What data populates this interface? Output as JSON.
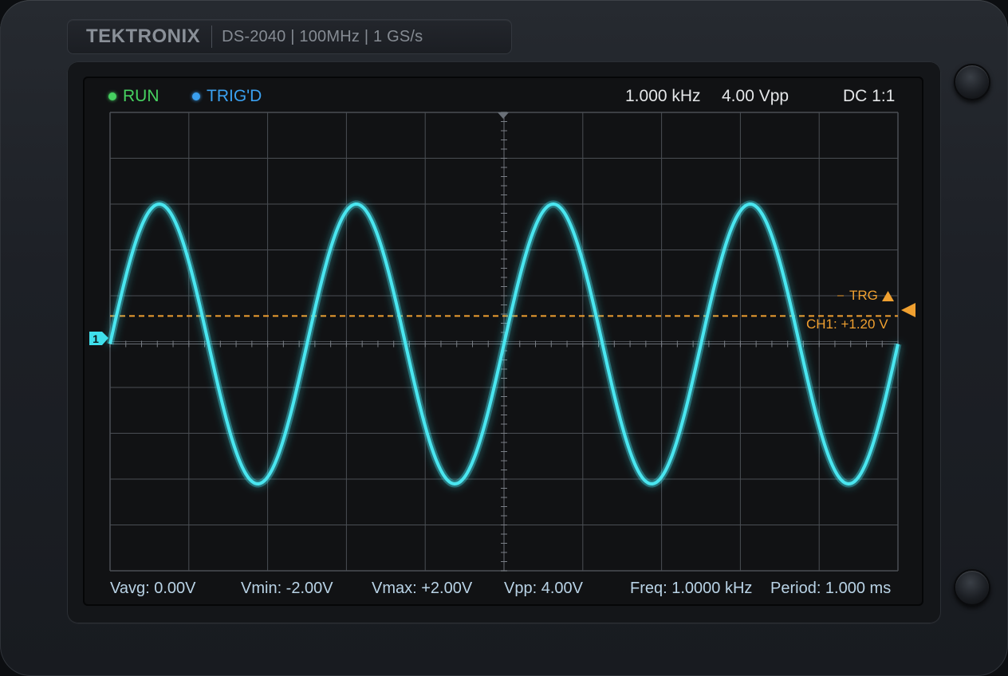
{
  "brand": {
    "name": "TEKTRONIX",
    "model": "DS-2040 | 100MHz | 1 GS/s"
  },
  "status": {
    "run": "RUN",
    "trigger": "TRIG'D"
  },
  "readout": {
    "frequency": "1.000 kHz",
    "vpp": "4.00 Vpp",
    "coupling": "DC 1:1"
  },
  "channel": {
    "marker": "1"
  },
  "trigger": {
    "label": "TRG",
    "level_text": "CH1: +1.20 V"
  },
  "measurements": {
    "vavg": "Vavg: 0.00V",
    "vmin": "Vmin: -2.00V",
    "vmax": "Vmax: +2.00V",
    "vpp": "Vpp: 4.00V",
    "freq": "Freq: 1.0000 kHz",
    "period": "Period: 1.000 ms"
  },
  "colors": {
    "trace": "#3fe0ec",
    "trigger": "#f0a030",
    "run": "#46d160",
    "trigd": "#3aa0f0",
    "grid": "#4a4e54"
  },
  "waveform": {
    "type": "sine",
    "cycles_visible": 4,
    "amplitude_divisions": 3,
    "trigger_level_divisions": 0.6
  }
}
